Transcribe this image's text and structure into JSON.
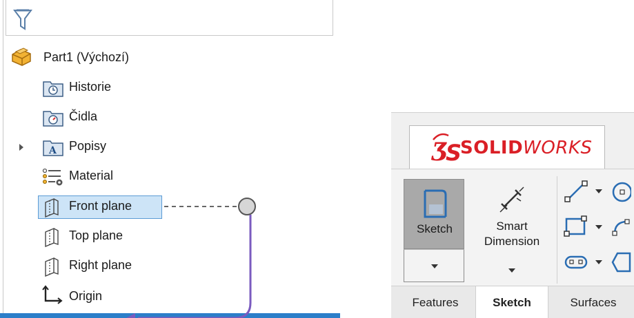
{
  "tree": {
    "part": {
      "label": "Part1  (Výchozí)"
    },
    "items": [
      {
        "label": "Historie"
      },
      {
        "label": "Čidla"
      },
      {
        "label": "Popisy"
      },
      {
        "label": "Material"
      },
      {
        "label": "Front plane"
      },
      {
        "label": "Top plane"
      },
      {
        "label": "Right plane"
      },
      {
        "label": "Origin"
      }
    ]
  },
  "ribbon": {
    "logo_ds": "ƷS",
    "logo_solid": "SOLID",
    "logo_works": "WORKS",
    "sketch_label": "Sketch",
    "smart_dimension_label_1": "Smart",
    "smart_dimension_label_2": "Dimension",
    "tabs": [
      {
        "label": "Features"
      },
      {
        "label": "Sketch"
      },
      {
        "label": "Surfaces"
      }
    ]
  },
  "colors": {
    "accent_blue": "#2c7ec9",
    "selection_bg": "#cde4f7",
    "connector_purple": "#7a5bbf",
    "logo_red": "#da1f26"
  }
}
